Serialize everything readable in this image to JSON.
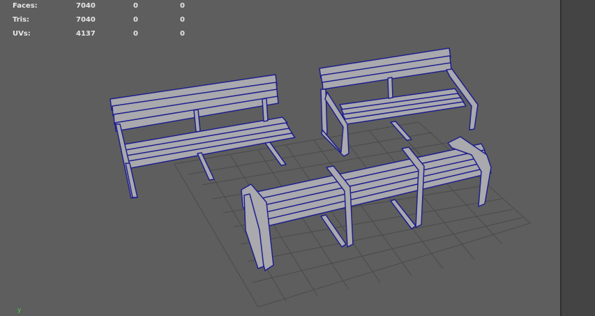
{
  "hud": {
    "rows": [
      {
        "label": "Faces:",
        "v1": "7040",
        "v2": "0",
        "v3": "0"
      },
      {
        "label": "Tris:",
        "v1": "7040",
        "v2": "0",
        "v3": "0"
      },
      {
        "label": "UVs:",
        "v1": "4137",
        "v2": "0",
        "v3": "0"
      }
    ]
  },
  "axis_label": "y",
  "colors": {
    "viewport_bg": "#5e5e5e",
    "grid": "#4a4a4a",
    "wireframe": "#1e1e8c",
    "model_fill": "#a9a9ae",
    "axis_y": "#46d246"
  },
  "scene": {
    "objects": [
      "bench-without-armrests",
      "bench-with-armrests",
      "bench-triple-seat"
    ]
  }
}
